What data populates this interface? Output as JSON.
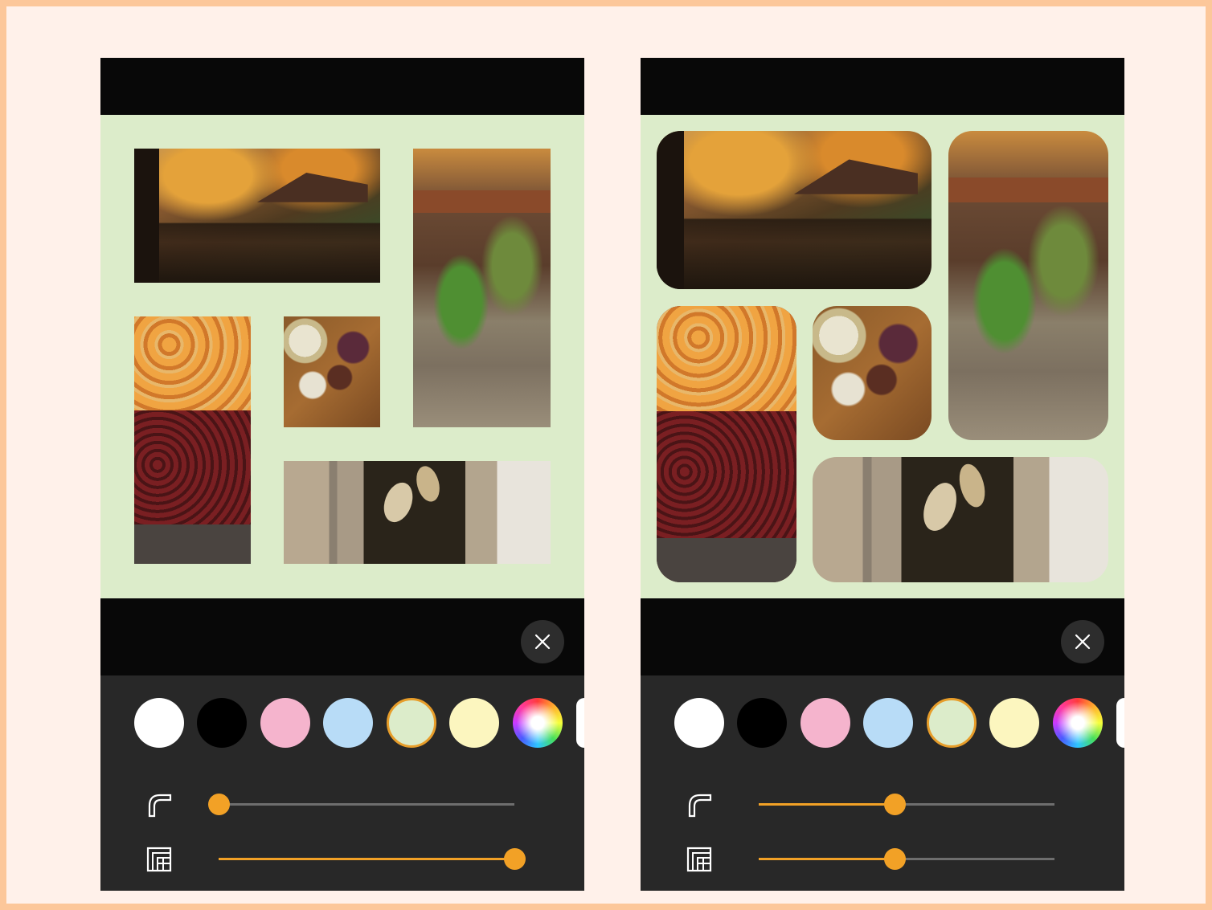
{
  "colors": {
    "frame_border": "#fcc79a",
    "frame_background": "#fff1ea",
    "canvas_background": "#dcecca",
    "accent": "#f2a126"
  },
  "screens": [
    {
      "id": "left",
      "corner_roundness": 0.0,
      "spacing": 1.0,
      "close_icon": "close-icon",
      "swatches": [
        "#ffffff",
        "#000000",
        "#f5b4cd",
        "#b8dcf7",
        "#dcecca",
        "#fcf6bf",
        "multicolor",
        "#ffffff"
      ],
      "selected_swatch": 4,
      "slider_icons": [
        "corner-radius-icon",
        "spacing-icon"
      ]
    },
    {
      "id": "right",
      "corner_roundness": 0.5,
      "spacing": 0.5,
      "close_icon": "close-icon",
      "swatches": [
        "#ffffff",
        "#000000",
        "#f5b4cd",
        "#b8dcf7",
        "#dcecca",
        "#fcf6bf",
        "multicolor",
        "#ffffff"
      ],
      "selected_swatch": 4,
      "slider_icons": [
        "corner-radius-icon",
        "spacing-icon"
      ]
    }
  ]
}
